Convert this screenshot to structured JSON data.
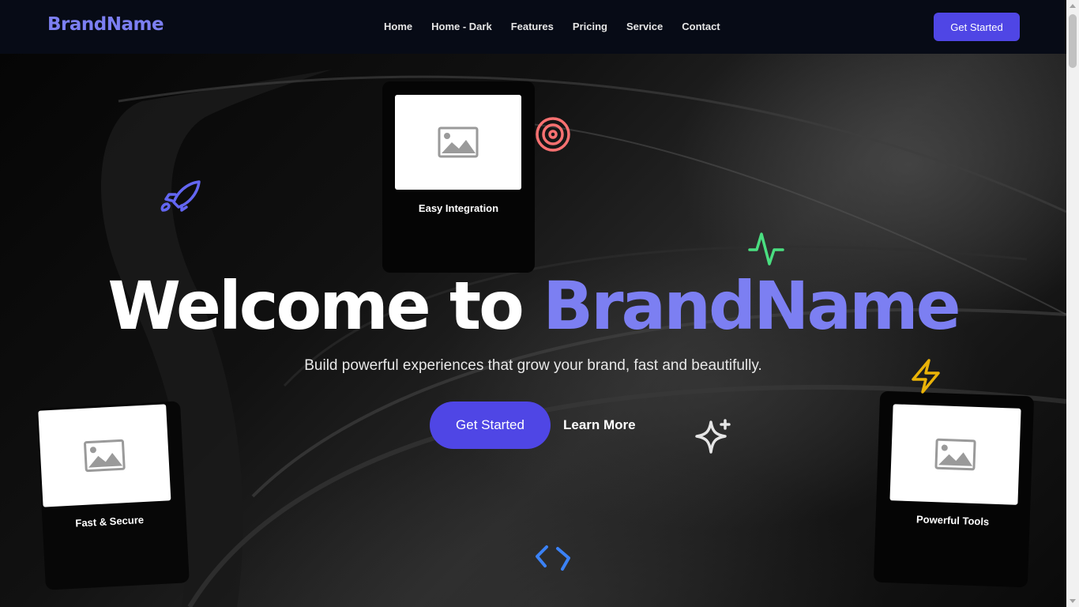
{
  "nav": {
    "brand": "BrandName",
    "links": [
      "Home",
      "Home - Dark",
      "Features",
      "Pricing",
      "Service",
      "Contact"
    ],
    "cta": "Get Started"
  },
  "hero": {
    "title_main": "Welcome to ",
    "title_accent": "BrandName",
    "subtitle": "Build powerful experiences that grow your brand, fast and beautifully.",
    "primary_cta": "Get Started",
    "secondary_cta": "Learn More"
  },
  "cards": [
    {
      "label": "Easy Integration",
      "image": "image-placeholder-icon"
    },
    {
      "label": "Fast & Secure",
      "image": "image-placeholder-icon"
    },
    {
      "label": "Powerful Tools",
      "image": "image-placeholder-icon"
    }
  ],
  "decorations": {
    "icons": [
      "rocket-icon",
      "target-icon",
      "activity-icon",
      "lightning-icon",
      "sparkles-icon",
      "code-icon"
    ]
  },
  "colors": {
    "accent": "#7c7ff2",
    "button": "#4f46e5",
    "nav_bg": "#070b16",
    "rocket": "#6366f1",
    "target": "#f87171",
    "activity": "#4ade80",
    "lightning": "#eab308",
    "sparkles": "#e5e5e5",
    "code": "#3b82f6"
  }
}
